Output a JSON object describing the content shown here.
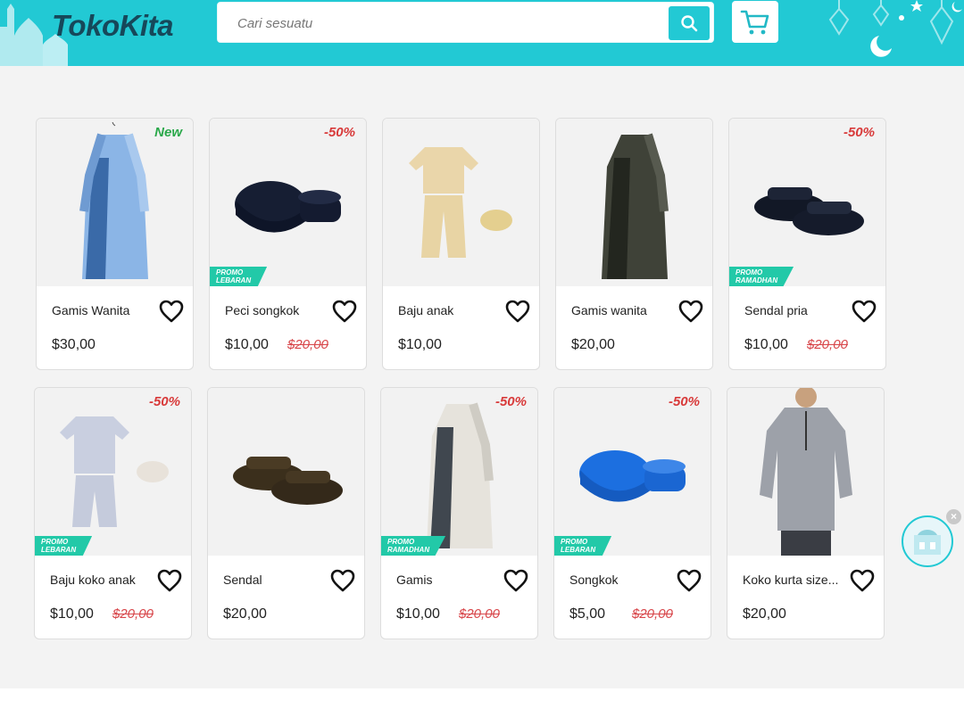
{
  "header": {
    "logo": "TokoKita",
    "search_placeholder": "Cari sesuatu",
    "brand_color": "#22c9d4"
  },
  "products": [
    {
      "name": "Gamis Wanita",
      "price": "$30,00",
      "old_price": "",
      "badge": "New",
      "promo": "",
      "image": "blue-gamis-dress"
    },
    {
      "name": "Peci songkok",
      "price": "$10,00",
      "old_price": "$20,00",
      "badge": "-50%",
      "promo": "PROMO LEBARAN",
      "image": "black-songkok"
    },
    {
      "name": "Baju anak",
      "price": "$10,00",
      "old_price": "",
      "badge": "",
      "promo": "",
      "image": "kids-beige-outfit"
    },
    {
      "name": "Gamis wanita",
      "price": "$20,00",
      "old_price": "",
      "badge": "",
      "promo": "",
      "image": "dark-gamis-dress"
    },
    {
      "name": "Sendal pria",
      "price": "$10,00",
      "old_price": "$20,00",
      "badge": "-50%",
      "promo": "PROMO RAMADHAN",
      "image": "black-sandals"
    },
    {
      "name": "Baju koko anak",
      "price": "$10,00",
      "old_price": "$20,00",
      "badge": "-50%",
      "promo": "PROMO LEBARAN",
      "image": "kids-grey-koko"
    },
    {
      "name": "Sendal",
      "price": "$20,00",
      "old_price": "",
      "badge": "",
      "promo": "",
      "image": "brown-sandals"
    },
    {
      "name": "Gamis",
      "price": "$10,00",
      "old_price": "$20,00",
      "badge": "-50%",
      "promo": "PROMO RAMADHAN",
      "image": "white-gamis-dress"
    },
    {
      "name": "Songkok",
      "price": "$5,00",
      "old_price": "$20,00",
      "badge": "-50%",
      "promo": "PROMO LEBARAN",
      "image": "blue-songkok"
    },
    {
      "name": "Koko kurta size...",
      "price": "$20,00",
      "old_price": "",
      "badge": "",
      "promo": "",
      "image": "grey-kurta-man"
    }
  ]
}
